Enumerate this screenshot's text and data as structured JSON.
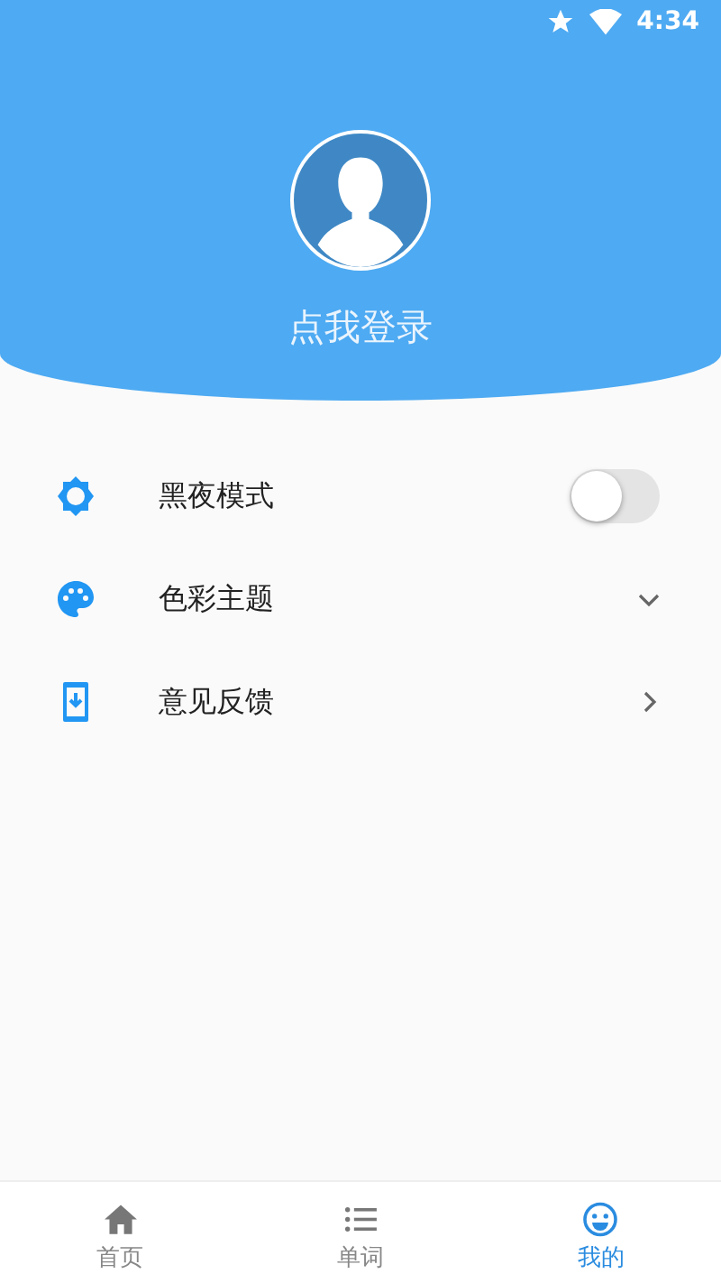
{
  "status_bar": {
    "time": "4:34"
  },
  "profile": {
    "login_label": "点我登录"
  },
  "menu": [
    {
      "kind": "toggle",
      "label": "黑夜模式",
      "on": false
    },
    {
      "kind": "dropdown",
      "label": "色彩主题",
      "expanded": false
    },
    {
      "kind": "link",
      "label": "意见反馈"
    }
  ],
  "tabs": [
    {
      "kind": "home",
      "label": "首页",
      "selected": false
    },
    {
      "kind": "list",
      "label": "单词",
      "selected": false
    },
    {
      "kind": "me",
      "label": "我的",
      "selected": true
    }
  ]
}
